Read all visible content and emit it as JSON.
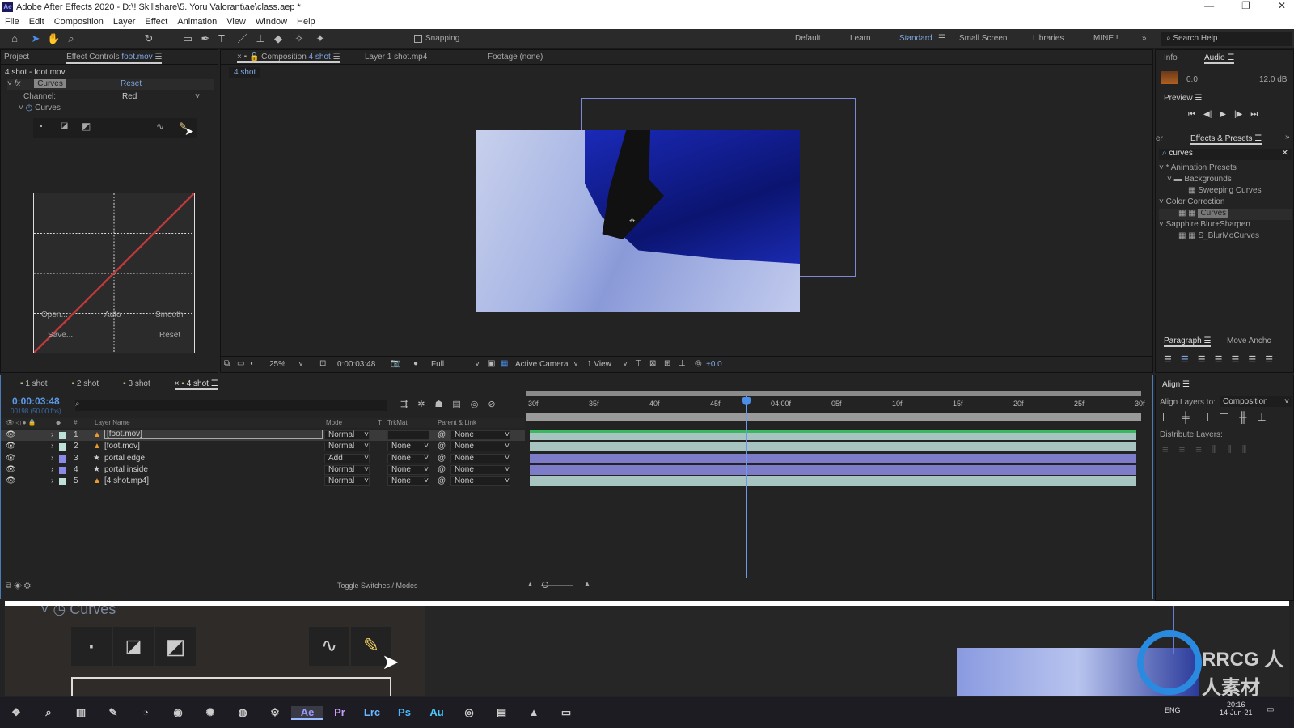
{
  "window": {
    "title": "Adobe After Effects 2020 - D:\\! Skillshare\\5. Yoru Valorant\\ae\\class.aep *",
    "logo": "Ae",
    "controls": [
      "—",
      "❐",
      "✕"
    ]
  },
  "menu": [
    "File",
    "Edit",
    "Composition",
    "Layer",
    "Effect",
    "Animation",
    "View",
    "Window",
    "Help"
  ],
  "toolbar": {
    "snapping": "Snapping",
    "workspaces": [
      "Default",
      "Learn",
      "Standard",
      "Small Screen",
      "Libraries",
      "MINE !"
    ],
    "active_workspace": "Standard",
    "search_placeholder": "Search Help"
  },
  "left_panel": {
    "tabs": [
      "Project",
      "Effect Controls"
    ],
    "effect_controls_layer": "foot.mov",
    "breadcrumb": "4 shot - foot.mov",
    "effect_name": "Curves",
    "reset": "Reset",
    "channel_label": "Channel:",
    "channel_value": "Red",
    "curves_label": "Curves",
    "buttons": [
      "Open...",
      "Auto",
      "Smooth",
      "Save...",
      "Reset"
    ],
    "curve_color": "#c0393b"
  },
  "composition": {
    "tab_label": "Composition",
    "comp_name": "4 shot",
    "layer_tab": "Layer  1 shot.mp4",
    "footage_tab": "Footage (none)",
    "comp_breadcrumb": "4 shot",
    "zoom": "25%",
    "timecode": "0:00:03:48",
    "resolution": "Full",
    "camera": "Active Camera",
    "views": "1 View",
    "exposure": "+0.0"
  },
  "right_panel": {
    "info_tab": "Info",
    "audio_tab": "Audio",
    "audio_left": "0.0",
    "audio_right": "12.0 dB",
    "preview": "Preview",
    "effects_tab": "Effects & Presets",
    "effects_cut": "er",
    "search_value": "curves",
    "tree": [
      {
        "label": "* Animation Presets",
        "level": 0
      },
      {
        "label": "Backgrounds",
        "level": 1
      },
      {
        "label": "Sweeping Curves",
        "level": 2
      },
      {
        "label": "Color Correction",
        "level": 0
      },
      {
        "label": "Curves",
        "level": 2,
        "selected": true
      },
      {
        "label": "Sapphire Blur+Sharpen",
        "level": 0
      },
      {
        "label": "S_BlurMoCurves",
        "level": 2
      }
    ],
    "paragraph_tab": "Paragraph",
    "move_anchor_tab": "Move Anchc",
    "align_tab": "Align",
    "align_layers_to": "Align Layers to:",
    "align_target": "Composition",
    "distribute": "Distribute Layers:"
  },
  "timeline": {
    "tabs": [
      "1 shot",
      "2 shot",
      "3 shot",
      "4 shot"
    ],
    "active_tab": "4 shot",
    "timecode": "0:00:03:48",
    "frame_info": "00198 (50.00 fps)",
    "columns": {
      "name": "Layer Name",
      "mode": "Mode",
      "t": "T",
      "trkmat": "TrkMat",
      "parent": "Parent & Link"
    },
    "layers": [
      {
        "num": "1",
        "name": "[foot.mov]",
        "type": "footage",
        "color": "#bfe0d8",
        "mode": "Normal",
        "trkmat": "",
        "parent": "None",
        "selected": true
      },
      {
        "num": "2",
        "name": "[foot.mov]",
        "type": "footage",
        "color": "#bfe0d8",
        "mode": "Normal",
        "trkmat": "None",
        "parent": "None"
      },
      {
        "num": "3",
        "name": "portal edge",
        "type": "shape",
        "color": "#8a8ae8",
        "mode": "Add",
        "trkmat": "None",
        "parent": "None"
      },
      {
        "num": "4",
        "name": "portal inside",
        "type": "shape",
        "color": "#8a8ae8",
        "mode": "Normal",
        "trkmat": "None",
        "parent": "None"
      },
      {
        "num": "5",
        "name": "[4 shot.mp4]",
        "type": "footage",
        "color": "#bfe0d8",
        "mode": "Normal",
        "trkmat": "None",
        "parent": "None"
      }
    ],
    "ruler": [
      "30f",
      "35f",
      "40f",
      "45f",
      "04:00f",
      "05f",
      "10f",
      "15f",
      "20f",
      "25f",
      "30f"
    ],
    "toggle": "Toggle Switches / Modes"
  },
  "overlay": {
    "curves_label": "Curves",
    "watermark": "RRCG 人人素材"
  },
  "taskbar": {
    "apps": [
      "❖",
      "⌕",
      "▥",
      "✎",
      "◔",
      "◉",
      "✺",
      "◍",
      "⚙",
      "Ae",
      "Pr",
      "Lrc",
      "Ps",
      "Au",
      "◎",
      "▤",
      "▲",
      "▭"
    ],
    "lang": "ENG",
    "time": "20:16",
    "date": "14-Jun-21"
  }
}
